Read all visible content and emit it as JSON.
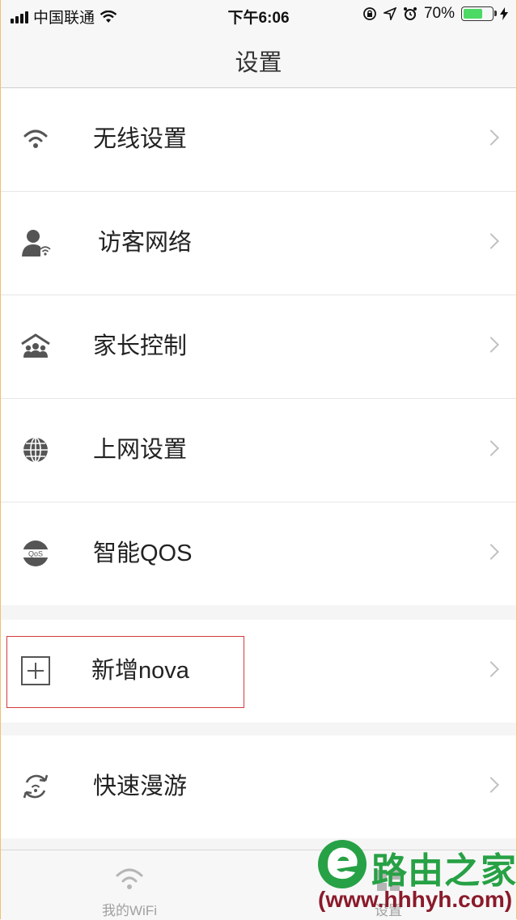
{
  "status_bar": {
    "carrier": "中国联通",
    "time": "下午6:06",
    "battery_percent": "70%",
    "battery_level": 0.7
  },
  "nav": {
    "title": "设置"
  },
  "settings": {
    "items": [
      {
        "label": "无线设置",
        "icon": "wifi-icon"
      },
      {
        "label": "访客网络",
        "icon": "guest-user-icon"
      },
      {
        "label": "家长控制",
        "icon": "family-icon"
      },
      {
        "label": "上网设置",
        "icon": "globe-icon"
      },
      {
        "label": "智能QOS",
        "icon": "qos-icon"
      }
    ],
    "add_nova": {
      "label": "新增nova",
      "icon": "plus-square-icon"
    },
    "roaming": {
      "label": "快速漫游",
      "icon": "roaming-icon"
    }
  },
  "tab_bar": {
    "tabs": [
      {
        "label": "我的WiFi",
        "icon": "wifi-icon"
      },
      {
        "label": "设置",
        "icon": "settings-icon"
      }
    ]
  },
  "watermark": {
    "brand": "路由之家",
    "url": "(www.hhhyh.com)"
  },
  "colors": {
    "highlight": "#d23a3a",
    "chevron": "#c0c0c0",
    "watermark_green": "#27a145"
  }
}
